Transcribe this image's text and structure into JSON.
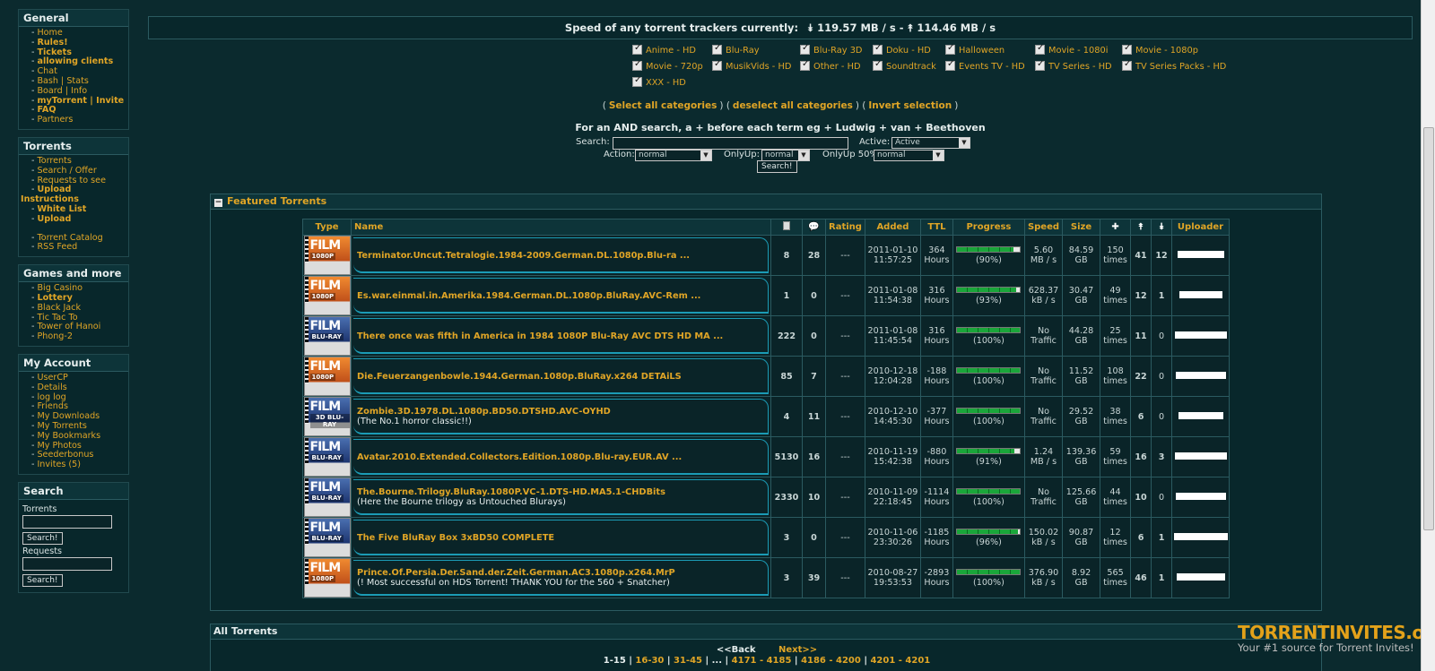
{
  "sidebar": {
    "general": {
      "title": "General",
      "items": [
        "Home",
        "Rules!",
        "Tickets",
        "allowing clients",
        "Chat",
        "Bash | Stats",
        "Board | Info",
        "myTorrent | Invite",
        "FAQ",
        "Partners"
      ]
    },
    "torrents": {
      "title": "Torrents",
      "items": [
        "Torrents",
        "Search / Offer",
        "Requests to see",
        "Upload",
        "Instructions",
        "White List",
        "Upload",
        "Torrent Catalog",
        "RSS Feed"
      ]
    },
    "games": {
      "title": "Games and more",
      "items": [
        "Big Casino",
        "Lottery",
        "Black Jack",
        "Tic Tac To",
        "Tower of Hanoi",
        "Phong-2"
      ]
    },
    "account": {
      "title": "My Account",
      "items": [
        "UserCP",
        "Details",
        "log log",
        "Friends",
        "My Downloads",
        "My Torrents",
        "My Bookmarks",
        "My Photos",
        "Seederbonus",
        "Invites (5)"
      ]
    },
    "search": {
      "title": "Search",
      "torrents_label": "Torrents",
      "requests_label": "Requests",
      "button": "Search!"
    }
  },
  "speed": {
    "label": "Speed of any torrent trackers currently:",
    "down": "119.57 MB / s -",
    "up": "114.46 MB / s"
  },
  "categories": [
    "Anime - HD",
    "Blu-Ray",
    "Blu-Ray 3D",
    "Doku - HD",
    "Halloween",
    "Movie - 1080i",
    "Movie - 1080p",
    "Movie - 720p",
    "MusikVids - HD",
    "Other - HD",
    "Soundtrack",
    "Events TV - HD",
    "TV Series - HD",
    "TV Series Packs - HD",
    "XXX - HD"
  ],
  "select_links": {
    "select_all": "Select all categories",
    "deselect_all": "deselect all categories",
    "invert": "Invert selection"
  },
  "and_tip": "For an AND search, a + before each term eg + Ludwig + van + Beethoven",
  "search_form": {
    "search_label": "Search:",
    "active_label": "Active:",
    "active_value": "Active",
    "action_label": "Action:",
    "action_value": "normal",
    "onlyup_label": "OnlyUp:",
    "onlyup_value": "normal",
    "onlyup50_label": "OnlyUp 50%",
    "onlyup50_value": "normal",
    "button": "Search!"
  },
  "featured": {
    "title": "Featured Torrents",
    "headers": {
      "type": "Type",
      "name": "Name",
      "rating": "Rating",
      "added": "Added",
      "ttl": "TTL",
      "progress": "Progress",
      "speed": "Speed",
      "size": "Size",
      "uploader": "Uploader"
    },
    "rows": [
      {
        "poster": "orange",
        "format": "1080P",
        "title": "Terminator.Uncut.Tetralogie.1984-2009.German.DL.1080p.Blu-ra ...",
        "sub": "",
        "files": "8",
        "comments": "28",
        "rating": "---",
        "date": "2011-01-10",
        "time": "11:57:25",
        "ttl1": "364",
        "ttl2": "Hours",
        "progress": 0.9,
        "progress_text": "(90%)",
        "speed1": "5.60",
        "speed2": "MB / s",
        "size1": "84.59",
        "size2": "GB",
        "snatched1": "150",
        "snatched2": "times",
        "seeders": "41",
        "leechers": "12"
      },
      {
        "poster": "orange",
        "format": "1080P",
        "title": "Es.war.einmal.in.Amerika.1984.German.DL.1080p.BluRay.AVC-Rem ...",
        "sub": "",
        "files": "1",
        "comments": "0",
        "rating": "---",
        "date": "2011-01-08",
        "time": "11:54:38",
        "ttl1": "316",
        "ttl2": "Hours",
        "progress": 0.93,
        "progress_text": "(93%)",
        "speed1": "628.37",
        "speed2": "kB / s",
        "size1": "30.47",
        "size2": "GB",
        "snatched1": "49",
        "snatched2": "times",
        "seeders": "12",
        "leechers": "1"
      },
      {
        "poster": "blue",
        "format": "BLU-RAY",
        "title": "There once was fifth in America in 1984 1080P Blu-Ray AVC DTS HD MA ...",
        "sub": "",
        "files": "222",
        "comments": "0",
        "rating": "---",
        "date": "2011-01-08",
        "time": "11:45:54",
        "ttl1": "316",
        "ttl2": "Hours",
        "progress": 1.0,
        "progress_text": "(100%)",
        "speed1": "No",
        "speed2": "Traffic",
        "size1": "44.28",
        "size2": "GB",
        "snatched1": "25",
        "snatched2": "times",
        "seeders": "11",
        "leechers": "0"
      },
      {
        "poster": "orange",
        "format": "1080P",
        "title": "Die.Feuerzangenbowle.1944.German.1080p.BluRay.x264 DETAiLS",
        "sub": "",
        "files": "85",
        "comments": "7",
        "rating": "---",
        "date": "2010-12-18",
        "time": "12:04:28",
        "ttl1": "-188",
        "ttl2": "Hours",
        "progress": 1.0,
        "progress_text": "(100%)",
        "speed1": "No",
        "speed2": "Traffic",
        "size1": "11.52",
        "size2": "GB",
        "snatched1": "108",
        "snatched2": "times",
        "seeders": "22",
        "leechers": "0"
      },
      {
        "poster": "blue",
        "format": "3D BLU-RAY",
        "title": "Zombie.3D.1978.DL.1080p.BD50.DTSHD.AVC-OYHD",
        "sub": "(The No.1 horror classic!!)",
        "files": "4",
        "comments": "11",
        "rating": "---",
        "date": "2010-12-10",
        "time": "14:45:30",
        "ttl1": "-377",
        "ttl2": "Hours",
        "progress": 1.0,
        "progress_text": "(100%)",
        "speed1": "No",
        "speed2": "Traffic",
        "size1": "29.52",
        "size2": "GB",
        "snatched1": "38",
        "snatched2": "times",
        "seeders": "6",
        "leechers": "0"
      },
      {
        "poster": "blue",
        "format": "BLU-RAY",
        "title": "Avatar.2010.Extended.Collectors.Edition.1080p.Blu-ray.EUR.AV ...",
        "sub": "",
        "files": "5130",
        "comments": "16",
        "rating": "---",
        "date": "2010-11-19",
        "time": "15:42:38",
        "ttl1": "-880",
        "ttl2": "Hours",
        "progress": 0.91,
        "progress_text": "(91%)",
        "speed1": "1.24",
        "speed2": "MB / s",
        "size1": "139.36",
        "size2": "GB",
        "snatched1": "59",
        "snatched2": "times",
        "seeders": "16",
        "leechers": "3"
      },
      {
        "poster": "blue",
        "format": "BLU-RAY",
        "title": "The.Bourne.Trilogy.BluRay.1080P.VC-1.DTS-HD.MA5.1-CHDBits",
        "sub": "(Here the Bourne trilogy as Untouched Blurays)",
        "files": "2330",
        "comments": "10",
        "rating": "---",
        "date": "2010-11-09",
        "time": "22:18:45",
        "ttl1": "-1114",
        "ttl2": "Hours",
        "progress": 1.0,
        "progress_text": "(100%)",
        "speed1": "No",
        "speed2": "Traffic",
        "size1": "125.66",
        "size2": "GB",
        "snatched1": "44",
        "snatched2": "times",
        "seeders": "10",
        "leechers": "0"
      },
      {
        "poster": "blue",
        "format": "BLU-RAY",
        "title": "The Five BluRay Box 3xBD50 COMPLETE",
        "sub": "",
        "files": "3",
        "comments": "0",
        "rating": "---",
        "date": "2010-11-06",
        "time": "23:30:26",
        "ttl1": "-1185",
        "ttl2": "Hours",
        "progress": 0.96,
        "progress_text": "(96%)",
        "speed1": "150.02",
        "speed2": "kB / s",
        "size1": "90.87",
        "size2": "GB",
        "snatched1": "12",
        "snatched2": "times",
        "seeders": "6",
        "leechers": "1"
      },
      {
        "poster": "orange",
        "format": "1080P",
        "title": "Prince.Of.Persia.Der.Sand.der.Zeit.German.AC3.1080p.x264.MrP",
        "sub": "(! Most successful on HDS Torrent! THANK YOU for the 560 + Snatcher)",
        "files": "3",
        "comments": "39",
        "rating": "---",
        "date": "2010-08-27",
        "time": "19:53:53",
        "ttl1": "-2893",
        "ttl2": "Hours",
        "progress": 1.0,
        "progress_text": "(100%)",
        "speed1": "376.90",
        "speed2": "kB / s",
        "size1": "8.92",
        "size2": "GB",
        "snatched1": "565",
        "snatched2": "times",
        "seeders": "46",
        "leechers": "1"
      }
    ]
  },
  "all_torrents": {
    "title": "All Torrents",
    "back": "<<Back",
    "next": "Next>>",
    "pages": [
      "1-15",
      "16-30",
      "31-45",
      "...",
      "4171 - 4185",
      "4186 - 4200",
      "4201 - 4201"
    ]
  },
  "watermark": {
    "title": "TORRENTINVITES.org",
    "subtitle": "Your #1 source for Torrent Invites!"
  }
}
